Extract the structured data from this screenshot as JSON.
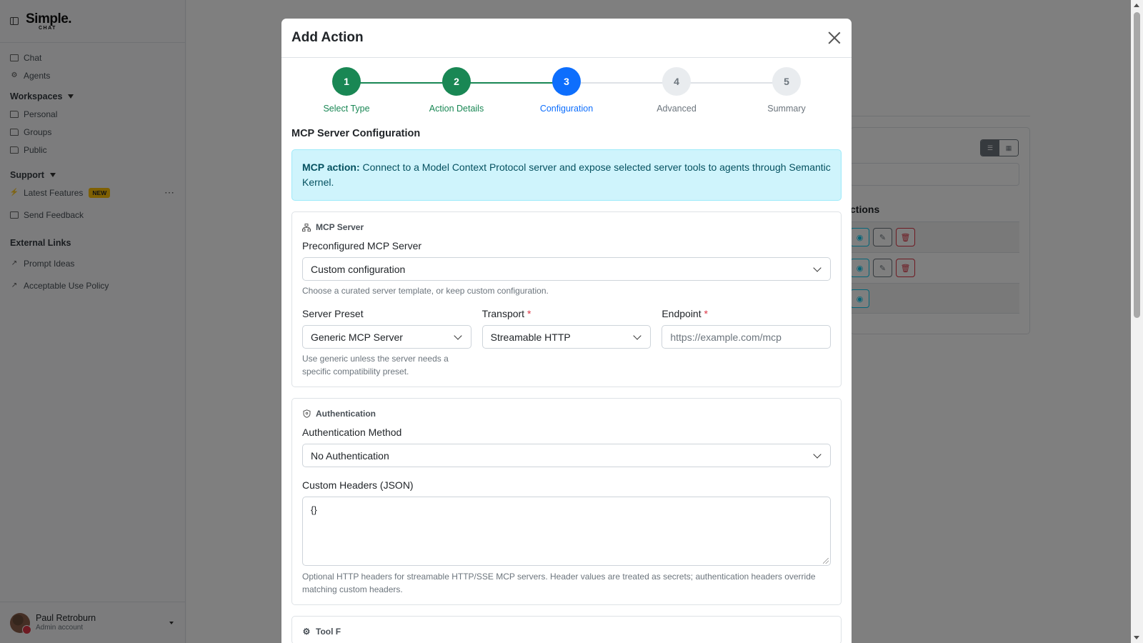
{
  "sidebar": {
    "logo": {
      "main": "Simple.",
      "sub": "CHAT"
    },
    "items": {
      "chat": "Chat",
      "agents": "Agents",
      "workspaces": "Workspaces",
      "personal": "Personal",
      "groups": "Groups",
      "public": "Public",
      "support": "Support",
      "latest_features": "Latest Features",
      "new_badge": "NEW",
      "send_feedback": "Send Feedback",
      "external_links": "External Links",
      "prompt_ideas": "Prompt Ideas",
      "acceptable_use": "Acceptable Use Policy"
    },
    "user": {
      "name": "Paul Retroburn",
      "role": "Admin account"
    }
  },
  "background": {
    "heading_fragment": "ctions"
  },
  "modal": {
    "title": "Add Action",
    "steps": [
      {
        "number": "1",
        "label": "Select Type",
        "state": "done"
      },
      {
        "number": "2",
        "label": "Action Details",
        "state": "done"
      },
      {
        "number": "3",
        "label": "Configuration",
        "state": "active"
      },
      {
        "number": "4",
        "label": "Advanced",
        "state": "todo"
      },
      {
        "number": "5",
        "label": "Summary",
        "state": "todo"
      }
    ],
    "section_title": "MCP Server Configuration",
    "alert": {
      "strong": "MCP action:",
      "text": " Connect to a Model Context Protocol server and expose selected server tools to agents through Semantic Kernel."
    },
    "mcp_server": {
      "heading": "MCP Server",
      "preconfigured_label": "Preconfigured MCP Server",
      "preconfigured_value": "Custom configuration",
      "preconfigured_help": "Choose a curated server template, or keep custom configuration.",
      "preset_label": "Server Preset",
      "preset_value": "Generic MCP Server",
      "preset_help": "Use generic unless the server needs a specific compatibility preset.",
      "transport_label": "Transport",
      "transport_value": "Streamable HTTP",
      "endpoint_label": "Endpoint",
      "endpoint_placeholder": "https://example.com/mcp",
      "required_mark": "*"
    },
    "authentication": {
      "heading": "Authentication",
      "method_label": "Authentication Method",
      "method_value": "No Authentication",
      "headers_label": "Custom Headers (JSON)",
      "headers_value": "{}",
      "headers_help": "Optional HTTP headers for streamable HTTP/SSE MCP servers. Header values are treated as secrets; authentication headers override matching custom headers."
    },
    "next_section_heading": "Tool F"
  },
  "colors": {
    "success": "#198754",
    "primary": "#0d6efd",
    "info_bg": "#cff4fc",
    "info_text": "#055160",
    "danger": "#dc3545"
  }
}
